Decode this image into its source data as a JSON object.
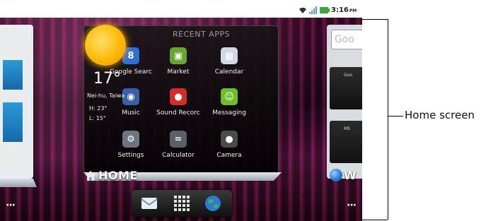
{
  "status_bar": {
    "time": "3:16",
    "ampm": "PM"
  },
  "recent_apps": {
    "title": "RECENT APPS",
    "apps": [
      {
        "label": "Google Searc",
        "icon": "google-search-icon",
        "glyph": "8",
        "color": "#2f6ed8"
      },
      {
        "label": "Market",
        "icon": "market-icon",
        "glyph": "▣",
        "color": "#6aa531"
      },
      {
        "label": "Calendar",
        "icon": "calendar-icon",
        "glyph": "▦",
        "color": "#cfd8e6"
      },
      {
        "label": "Music",
        "icon": "music-icon",
        "glyph": "◉",
        "color": "#3a5fa8"
      },
      {
        "label": "Sound Recorc",
        "icon": "microphone-icon",
        "glyph": "●",
        "color": "#d42b2b"
      },
      {
        "label": "Messaging",
        "icon": "messaging-icon",
        "glyph": "☺",
        "color": "#6fbf2a"
      },
      {
        "label": "Settings",
        "icon": "settings-icon",
        "glyph": "⚙",
        "color": "#6b7480"
      },
      {
        "label": "Calculator",
        "icon": "calculator-icon",
        "glyph": "=",
        "color": "#5b6068"
      },
      {
        "label": "Camera",
        "icon": "camera-icon",
        "glyph": "●",
        "color": "#4a4a4a"
      }
    ]
  },
  "weather": {
    "temp": "17°",
    "location": "Nei-hu, Taiwa",
    "high": "H:  23°",
    "low": "L:  15°"
  },
  "home": {
    "label": "HOME",
    "right_label": "W"
  },
  "right_panel": {
    "search_text": "Goo",
    "widget1": "Goo",
    "widget2": "MS"
  },
  "dock": {
    "left_dots": "···",
    "right_dots": "···"
  },
  "callout": {
    "label": "Home screen"
  }
}
